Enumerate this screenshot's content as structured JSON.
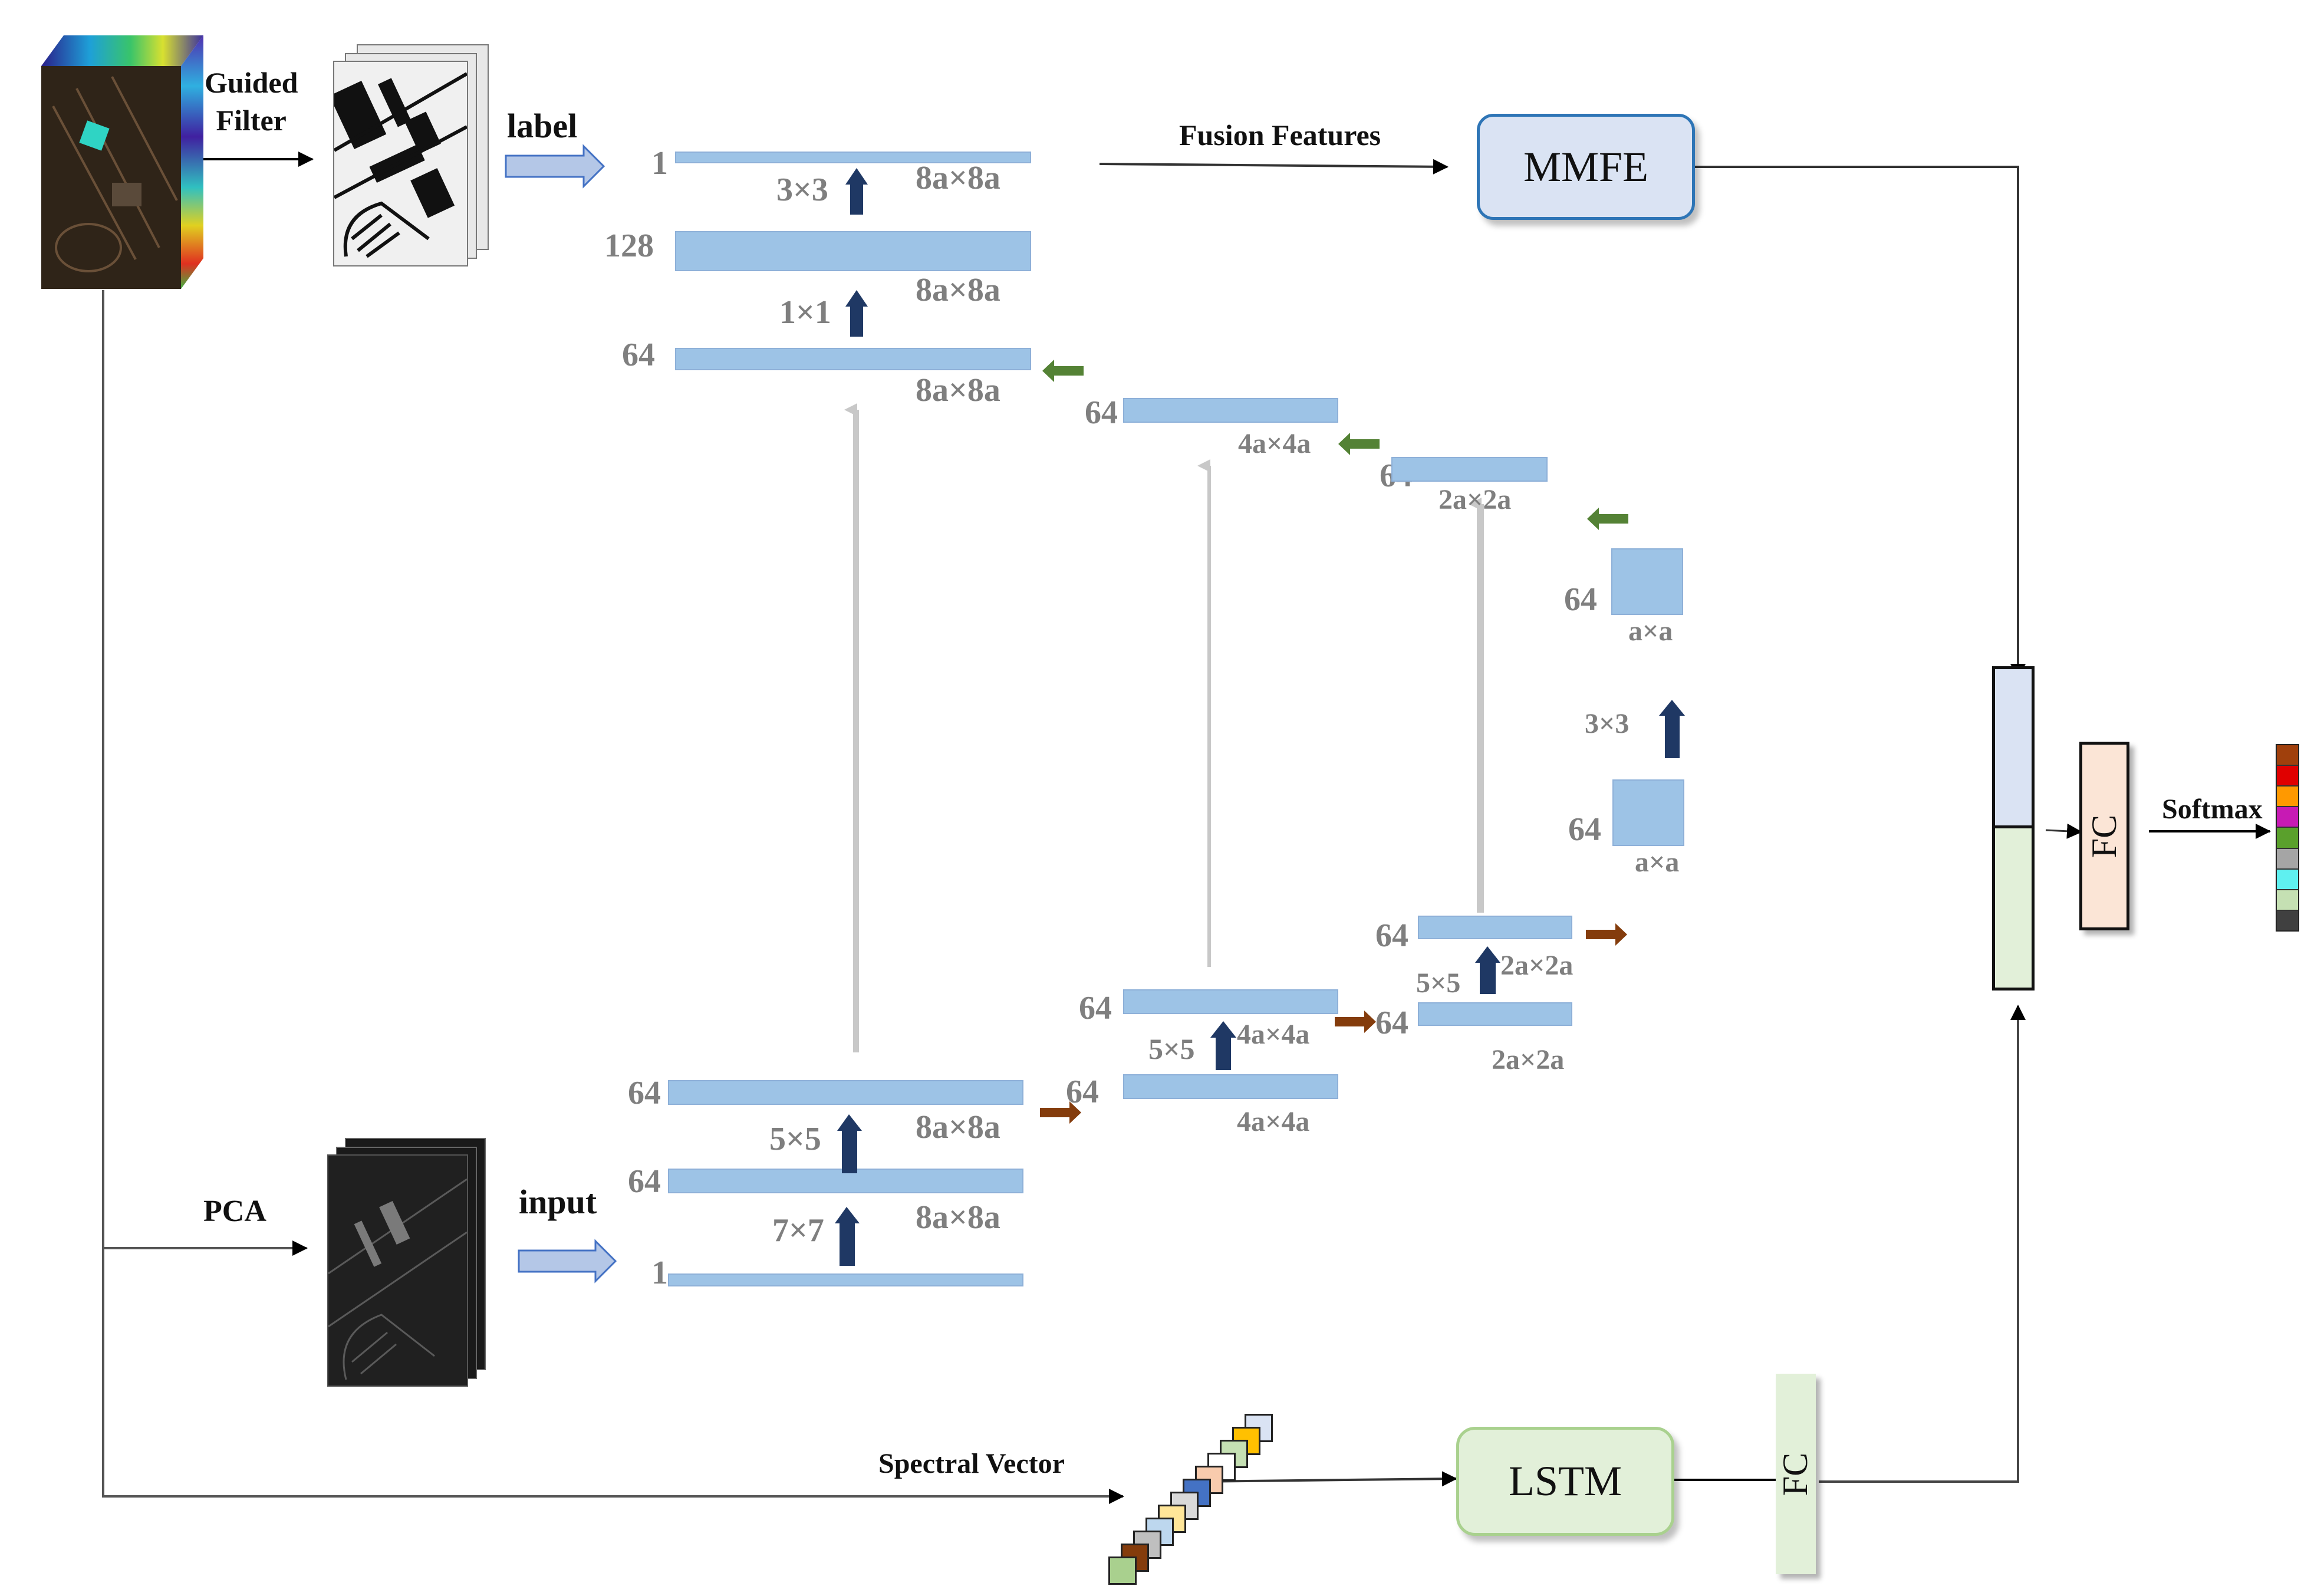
{
  "labels": {
    "guided_filter_line1": "Guided",
    "guided_filter_line2": "Filter",
    "label": "label",
    "fusion_features": "Fusion Features",
    "pca": "PCA",
    "input": "input",
    "spectral_vector": "Spectral Vector",
    "softmax": "Softmax"
  },
  "blocks": {
    "mmfe": "MMFE",
    "lstm": "LSTM",
    "fc_main": "FC",
    "fc_lstm": "FC"
  },
  "decoder": {
    "top_1": {
      "channels": "1",
      "size": "8a×8a",
      "kernel": "3×3"
    },
    "top_128": {
      "channels": "128",
      "size": "8a×8a",
      "kernel": "1×1"
    },
    "top_64": {
      "channels": "64",
      "size": "8a×8a"
    },
    "mid_64": {
      "channels": "64",
      "size": "4a×4a"
    },
    "low_64": {
      "channels": "64",
      "size": "2a×2a"
    }
  },
  "bottleneck": {
    "upper": {
      "channels": "64",
      "size": "a×a"
    },
    "kernel": "3×3",
    "lower": {
      "channels": "64",
      "size": "a×a"
    }
  },
  "encoder": {
    "in_1": {
      "channels": "1"
    },
    "e1_64a": {
      "channels": "64",
      "size": "8a×8a",
      "kernel": "7×7"
    },
    "e1_64b": {
      "channels": "64",
      "size": "8a×8a",
      "kernel": "5×5"
    },
    "e2_64a": {
      "channels": "64",
      "size": "4a×4a"
    },
    "e2_64b": {
      "channels": "64",
      "size": "4a×4a",
      "kernel": "5×5"
    },
    "e3_64a": {
      "channels": "64",
      "size": "2a×2a"
    },
    "e3_64b": {
      "channels": "64",
      "size": "2a×2a",
      "kernel": "5×5"
    }
  },
  "colors": {
    "feature_map": "#9dc3e6",
    "conv_arrow": "#1f3864",
    "skip_arrow_green": "#548235",
    "down_arrow_brown": "#843c0c",
    "concat_top": "#dae3f3",
    "concat_bottom": "#e2f0d9",
    "fc_main": "#fbe5d6",
    "fc_lstm": "#e2f0d9",
    "mmfe_fill": "#dae3f3",
    "lstm_fill": "#e2f0d9"
  },
  "output_classes": [
    "#a0400c",
    "#e00000",
    "#ff9900",
    "#c71ab4",
    "#5aa02c",
    "#a5a5a5",
    "#5ff0f0",
    "#c5e0b3",
    "#404040"
  ],
  "spectral_cells": [
    "#a9d08e",
    "#843c0c",
    "#bfbfbf",
    "#bdd7ee",
    "#ffe699",
    "#d9d9d9",
    "#4472c4",
    "#f8cbad",
    "#ffffff",
    "#c5e0b3",
    "#ffc000",
    "#dae3f3"
  ]
}
